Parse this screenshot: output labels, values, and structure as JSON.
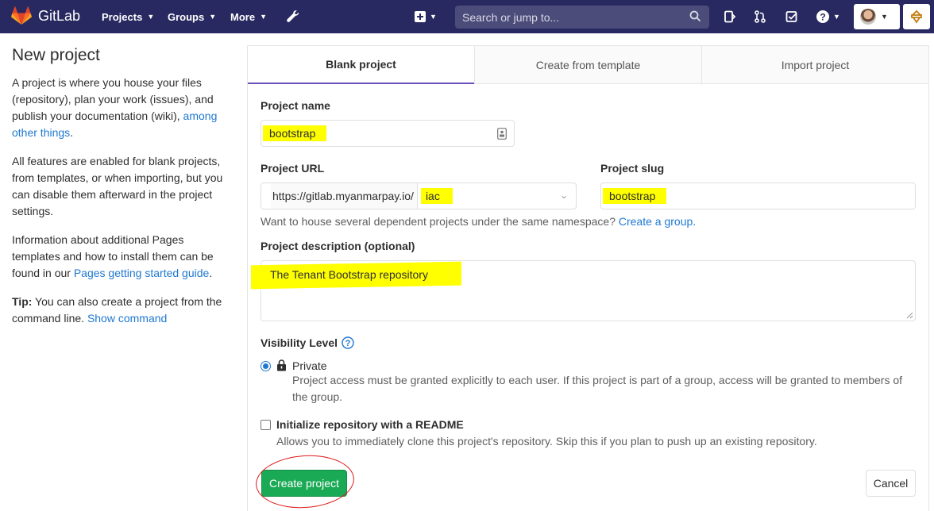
{
  "navbar": {
    "brand": "GitLab",
    "menu": [
      {
        "label": "Projects"
      },
      {
        "label": "Groups"
      },
      {
        "label": "More"
      }
    ],
    "search_placeholder": "Search or jump to..."
  },
  "sidebar": {
    "title": "New project",
    "p1_text": "A project is where you house your files (repository), plan your work (issues), and publish your documentation (wiki), ",
    "p1_link": "among other things",
    "p1_end": ".",
    "p2": "All features are enabled for blank projects, from templates, or when importing, but you can disable them afterward in the project settings.",
    "p3_text": "Information about additional Pages templates and how to install them can be found in our ",
    "p3_link": "Pages getting started guide",
    "p3_end": ".",
    "tip_label": "Tip:",
    "tip_text": " You can also create a project from the command line. ",
    "tip_link": "Show command"
  },
  "tabs": [
    {
      "label": "Blank project",
      "active": true
    },
    {
      "label": "Create from template",
      "active": false
    },
    {
      "label": "Import project",
      "active": false
    }
  ],
  "form": {
    "project_name_label": "Project name",
    "project_name_value": "bootstrap",
    "project_url_label": "Project URL",
    "url_prefix": "https://gitlab.myanmarpay.io/",
    "namespace_value": "iac",
    "project_slug_label": "Project slug",
    "project_slug_value": "bootstrap",
    "namespace_help": "Want to house several dependent projects under the same namespace? ",
    "namespace_help_link": "Create a group.",
    "description_label": "Project description (optional)",
    "description_value": "The Tenant Bootstrap repository",
    "visibility_label": "Visibility Level",
    "visibility_option": "Private",
    "visibility_help": "Project access must be granted explicitly to each user. If this project is part of a group, access will be granted to members of the group.",
    "readme_label": "Initialize repository with a README",
    "readme_help": "Allows you to immediately clone this project's repository. Skip this if you plan to push up an existing repository.",
    "create_button": "Create project",
    "cancel_button": "Cancel"
  },
  "colors": {
    "navbar": "#292961",
    "accent": "#6b4fbb",
    "create_button": "#1aaa55",
    "link": "#1f78d1",
    "highlight": "#ffff00"
  }
}
